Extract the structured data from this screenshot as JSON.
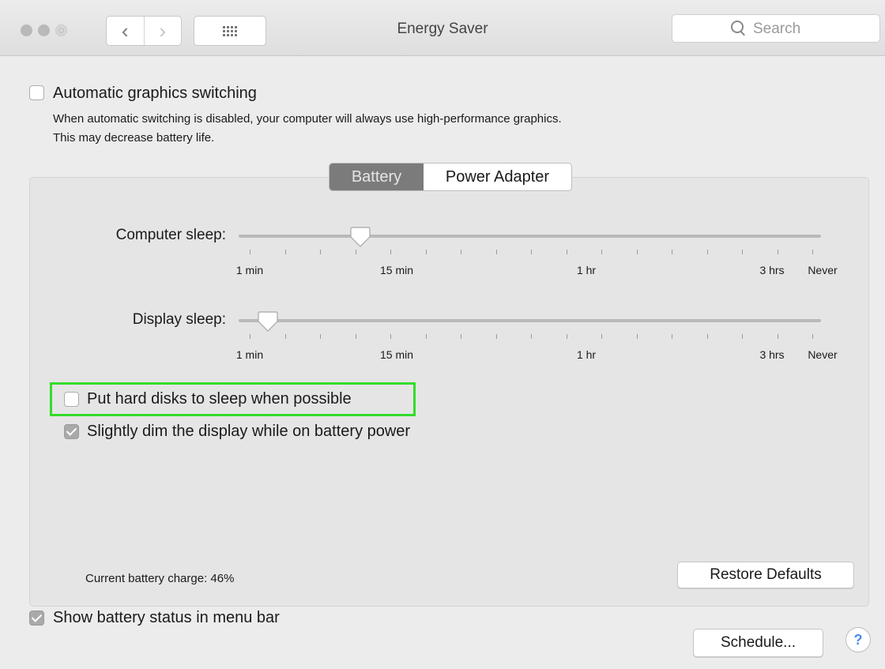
{
  "window": {
    "title": "Energy Saver",
    "back_glyph": "‹",
    "forward_glyph": "›",
    "search_placeholder": "Search"
  },
  "graphics": {
    "label": "Automatic graphics switching",
    "checked": false,
    "description_line1": "When automatic switching is disabled, your computer will always use high-performance graphics.",
    "description_line2": "This may decrease battery life."
  },
  "tabs": [
    {
      "label": "Battery",
      "active": true
    },
    {
      "label": "Power Adapter",
      "active": false
    }
  ],
  "sliders": {
    "tick_labels": [
      "1 min",
      "15 min",
      "1 hr",
      "3 hrs",
      "Never"
    ],
    "computer_sleep": {
      "label": "Computer sleep:",
      "value": "15 min"
    },
    "display_sleep": {
      "label": "Display sleep:",
      "value": "2 min"
    }
  },
  "options": {
    "hard_disks": {
      "label": "Put hard disks to sleep when possible",
      "checked": false
    },
    "dim_display": {
      "label": "Slightly dim the display while on battery power",
      "checked": true
    }
  },
  "battery": {
    "charge_text": "Current battery charge: 46%"
  },
  "buttons": {
    "restore_defaults": "Restore Defaults",
    "schedule": "Schedule...",
    "help": "?"
  },
  "menu_bar": {
    "label": "Show battery status in menu bar",
    "checked": true
  },
  "colors": {
    "highlight": "#33dc2b",
    "active_tab": "#7b7b7b",
    "help_accent": "#4a8cf0"
  }
}
